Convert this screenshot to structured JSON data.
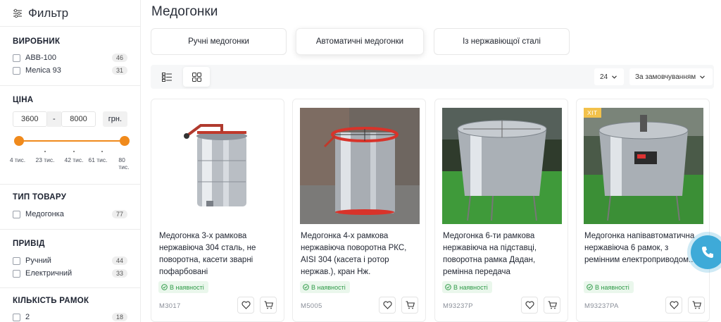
{
  "filter": {
    "title": "Фильтр",
    "producer": {
      "title": "ВИРОБНИК",
      "items": [
        {
          "label": "ABB-100",
          "count": "46"
        },
        {
          "label": "Меліса 93",
          "count": "31"
        }
      ]
    },
    "price": {
      "title": "ЦІНА",
      "min": "3600",
      "max": "8000",
      "dash": "-",
      "currency": "грн.",
      "ticks": [
        "4 тис.",
        "23 тис.",
        "42 тис.",
        "61 тис.",
        "80 тис."
      ],
      "accent": "#f08a1c"
    },
    "type": {
      "title": "ТИП ТОВАРУ",
      "items": [
        {
          "label": "Медогонка",
          "count": "77"
        }
      ]
    },
    "drive": {
      "title": "ПРИВІД",
      "items": [
        {
          "label": "Ручний",
          "count": "44"
        },
        {
          "label": "Електричний",
          "count": "33"
        }
      ]
    },
    "frames": {
      "title": "КІЛЬКІСТЬ РАМОК",
      "items": [
        {
          "label": "2",
          "count": "18"
        }
      ]
    }
  },
  "page": {
    "title": "Медогонки",
    "categories": [
      "Ручні медогонки",
      "Автоматичні медогонки",
      "Із нержавіющої сталі"
    ],
    "per_page": "24",
    "sort": "За замовчуванням"
  },
  "products": [
    {
      "name": "Медогонка 3-х рамкова нержавіюча 304 сталь, не поворотна, касети зварні пофарбовані",
      "stock": "В наявності",
      "sku": "M3017",
      "badge": ""
    },
    {
      "name": "Медогонка 4-х рамкова нержавіюча поворотна РКС, AISI 304 (касета і ротор нержав.), кран Нж.",
      "stock": "В наявності",
      "sku": "M5005",
      "badge": ""
    },
    {
      "name": "Медогонка 6-ти рамкова нержавіюча на підставці, поворотна рамка Дадан, ремінна передача",
      "stock": "В наявності",
      "sku": "M93237P",
      "badge": ""
    },
    {
      "name": "Медогонка напівавтоматична нержавіюча 6 рамок, з ремінним електроприводом...",
      "stock": "В наявності",
      "sku": "M93237PA",
      "badge": "ХІТ"
    }
  ],
  "icons": {
    "filter": "sliders-icon",
    "list_view": "list-view-icon",
    "grid_view": "grid-view-icon",
    "favorite": "heart-icon",
    "cart": "cart-icon",
    "stock": "check-circle-icon",
    "phone": "phone-icon"
  }
}
